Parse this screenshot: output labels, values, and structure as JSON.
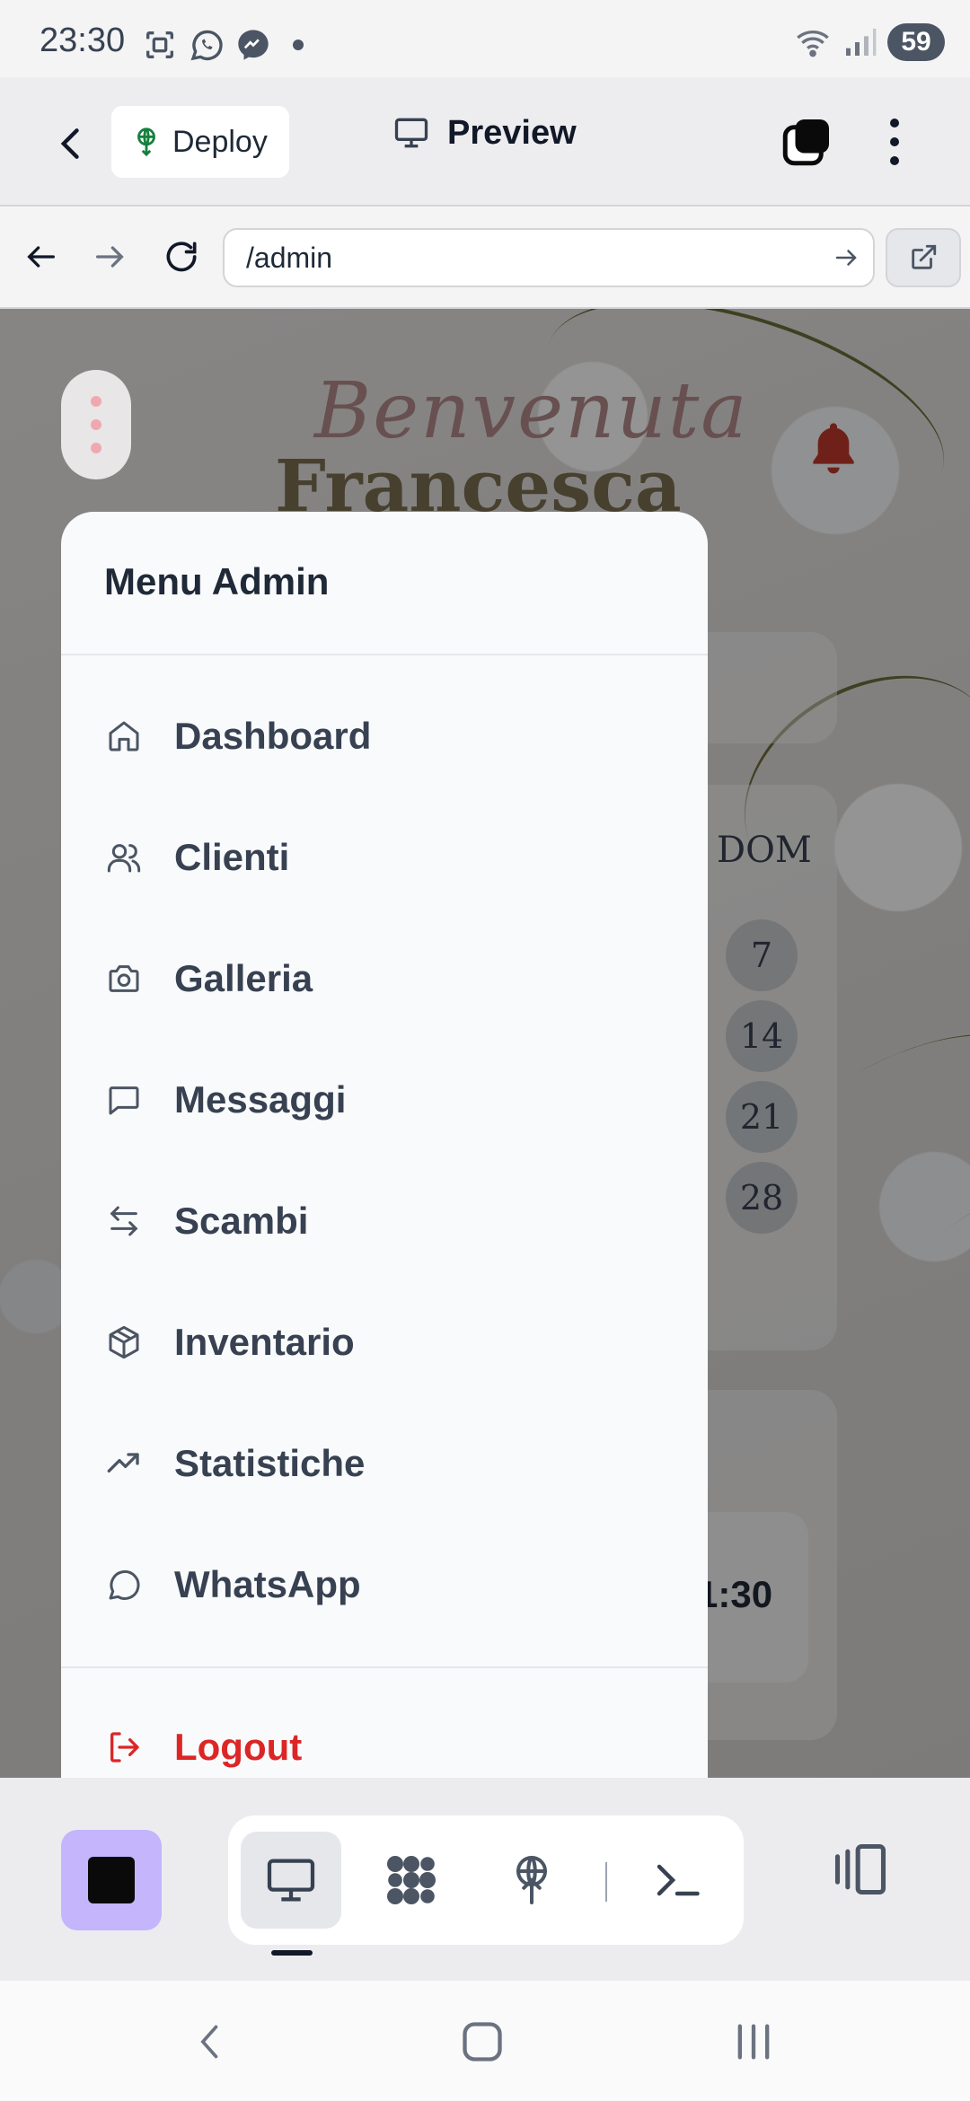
{
  "status_bar": {
    "time": "23:30",
    "battery": "59",
    "left_icons": [
      "screenshot-icon",
      "whatsapp-icon",
      "messenger-icon",
      "dot-icon"
    ],
    "right_icons": [
      "wifi-icon",
      "signal-icon"
    ]
  },
  "app_bar": {
    "deploy_label": "Deploy",
    "preview_label": "Preview"
  },
  "browser": {
    "url": "/admin"
  },
  "page": {
    "welcome_script": "Benvenuta",
    "welcome_name": "Francesca",
    "calendar_header": "DOM",
    "calendar_days": [
      "7",
      "14",
      "21",
      "28"
    ],
    "time_value": "1:30"
  },
  "menu": {
    "title": "Menu Admin",
    "items": [
      {
        "label": "Dashboard",
        "icon": "home-icon"
      },
      {
        "label": "Clienti",
        "icon": "users-icon"
      },
      {
        "label": "Galleria",
        "icon": "camera-icon"
      },
      {
        "label": "Messaggi",
        "icon": "message-square-icon"
      },
      {
        "label": "Scambi",
        "icon": "arrows-exchange-icon"
      },
      {
        "label": "Inventario",
        "icon": "package-icon"
      },
      {
        "label": "Statistiche",
        "icon": "trending-up-icon"
      },
      {
        "label": "WhatsApp",
        "icon": "message-circle-icon"
      }
    ],
    "logout_label": "Logout"
  },
  "toolbar": {
    "tools": [
      "monitor-icon",
      "apps-icon",
      "deploy-icon",
      "terminal-icon"
    ]
  },
  "colors": {
    "accent": "#c4b5fd",
    "logout": "#dc2626",
    "bell": "#c0392b"
  }
}
